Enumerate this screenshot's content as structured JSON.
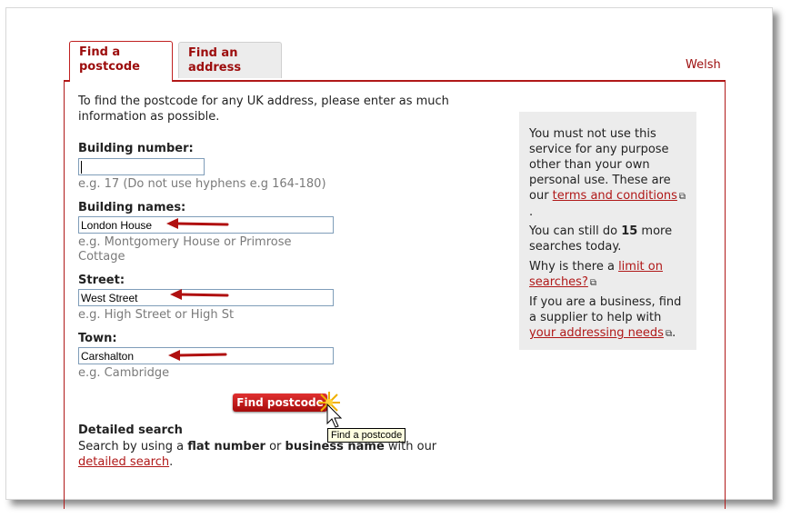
{
  "tabs": [
    {
      "label_line1": "Find a",
      "label_line2": "postcode"
    },
    {
      "label_line1": "Find an",
      "label_line2": "address"
    }
  ],
  "welsh_link": "Welsh",
  "intro": {
    "line1": "To find the postcode for any UK address, please enter as much",
    "line2": "information as possible."
  },
  "fields": {
    "building_number": {
      "label": "Building number:",
      "value": "",
      "hint": "e.g. 17 (Do not use hyphens e.g 164-180)"
    },
    "building_names": {
      "label": "Building names:",
      "value": "London House",
      "hint_line1": "e.g. Montgomery House or Primrose",
      "hint_line2": "Cottage"
    },
    "street": {
      "label": "Street:",
      "value": "West Street",
      "hint": "e.g. High Street or High St"
    },
    "town": {
      "label": "Town:",
      "value": "Carshalton",
      "hint": "e.g. Cambridge"
    }
  },
  "find_button": "Find postcode",
  "tooltip": "Find a postcode",
  "detailed": {
    "heading": "Detailed search",
    "text_prefix": "Search by using a ",
    "bold1": "flat number",
    "text_mid": " or ",
    "bold2": "business name",
    "text_suffix": " with our",
    "link": "detailed search",
    "end": "."
  },
  "sidebar": {
    "p1": {
      "l1": "You must not use this",
      "l2": "service for any purpose",
      "l3": "other than your own",
      "l4": "personal use. These are",
      "l5_prefix": "our ",
      "l5_link": "terms and conditions",
      "l6": "."
    },
    "p2": {
      "l1_prefix": "You can still do ",
      "count": "15",
      "l1_suffix": " more",
      "l2": "searches today."
    },
    "p3": {
      "l1_prefix": "Why is there a ",
      "l1_link": "limit on",
      "l2_link": "searches?"
    },
    "p4": {
      "l1": "If you are a business, find",
      "l2": "a supplier to help with",
      "l3_link": "your addressing needs",
      "l3_suffix": "."
    }
  },
  "colors": {
    "brand": "#9c0c0c",
    "button": "#c01818",
    "arrow": "#b01010"
  }
}
